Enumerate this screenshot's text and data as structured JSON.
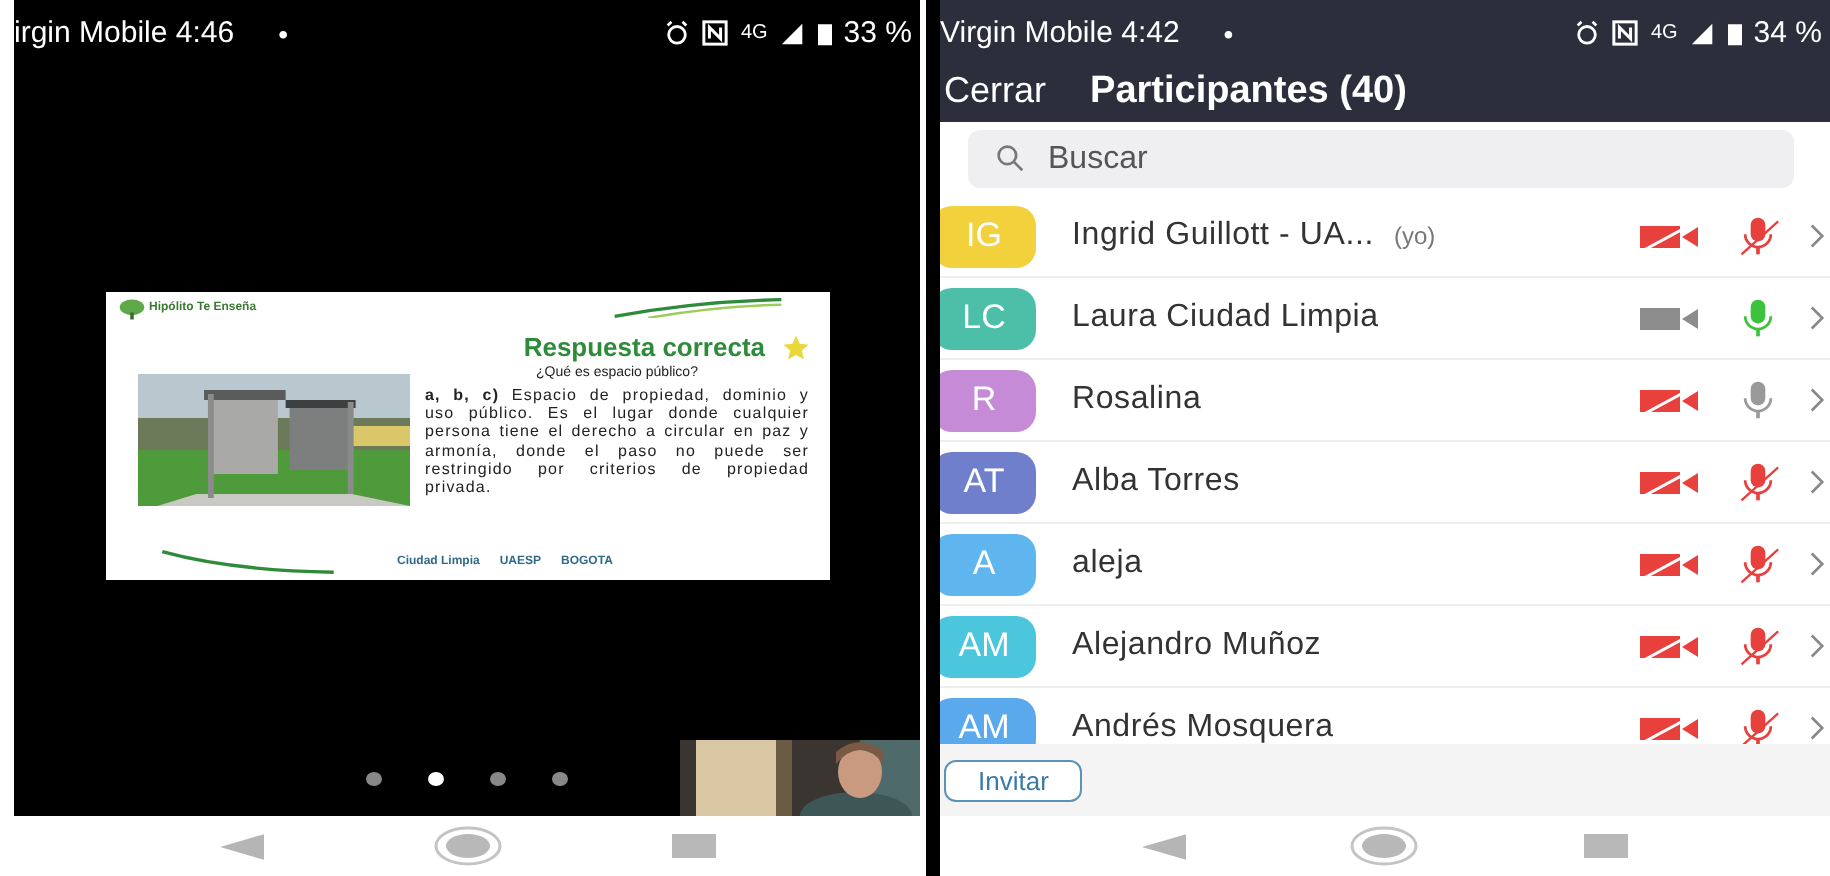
{
  "left_phone": {
    "status_bar": {
      "carrier_time": "irgin Mobile 4:46",
      "dot": "•",
      "network": "4G",
      "battery": "33 %"
    },
    "slide": {
      "brand": "Hipólito Te Enseña",
      "title": "Respuesta correcta",
      "question": "¿Qué es espacio público?",
      "answer": "**a, b, c)** Espacio de propiedad, dominio y uso público. Es el lugar donde cualquier persona tiene el derecho a circular en paz y armonía, donde el paso no puede ser restringido por criterios de propiedad privada.",
      "logos": [
        "Ciudad Limpia",
        "UAESP",
        "BOGOTA"
      ]
    },
    "page_dots": [
      {
        "selected": false
      },
      {
        "selected": true
      },
      {
        "selected": false
      },
      {
        "selected": false
      }
    ]
  },
  "right_phone": {
    "status_bar": {
      "carrier_time": "Virgin Mobile 4:42",
      "dot": "•",
      "network": "4G",
      "battery": "34 %"
    },
    "header": {
      "close": "Cerrar",
      "title": "Participantes (40)"
    },
    "search": {
      "placeholder": "Buscar"
    },
    "participants": [
      {
        "initials": "IG",
        "color": "#f2d13c",
        "name": "Ingrid Guillott - UA...",
        "tag": "(yo)",
        "video_on": false,
        "mic_muted": true
      },
      {
        "initials": "LC",
        "color": "#4dbfa8",
        "name": "Laura Ciudad Limpia",
        "video_on": true,
        "mic_muted": false,
        "speaking": true
      },
      {
        "initials": "R",
        "color": "#c58bd6",
        "name": "Rosalina",
        "video_on": false,
        "mic_muted": false,
        "speaking": false
      },
      {
        "initials": "AT",
        "color": "#6f7fcc",
        "name": "Alba Torres",
        "video_on": false,
        "mic_muted": true
      },
      {
        "initials": "A",
        "color": "#5fb6ee",
        "name": "aleja",
        "video_on": false,
        "mic_muted": true
      },
      {
        "initials": "AM",
        "color": "#4cc6dc",
        "name": "Alejandro Muñoz",
        "video_on": false,
        "mic_muted": true
      },
      {
        "initials": "AM",
        "color": "#5aa9ec",
        "name": "Andrés Mosquera",
        "video_on": false,
        "mic_muted": true
      }
    ],
    "invite": "Invitar"
  }
}
